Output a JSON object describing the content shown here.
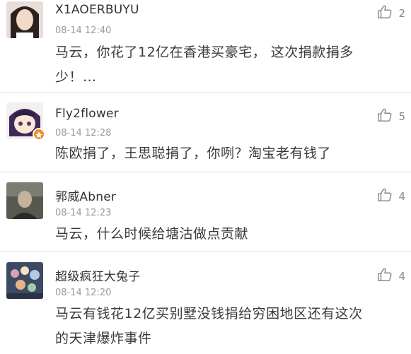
{
  "comments": [
    {
      "username": "X1AOERBUYU",
      "time": "08-14 12:40",
      "text_line1": "马云，你花了12亿在香港买豪宅， 这次捐款捐多",
      "text_line2": "少！…",
      "likes": "2",
      "avatar": "avatar-girl",
      "badge": false
    },
    {
      "username": "Fly2flower",
      "time": "08-14 12:28",
      "text_line1": "陈欧捐了，王思聪捐了，你咧？淘宝老有钱了",
      "text_line2": "",
      "likes": "5",
      "avatar": "avatar-anime",
      "badge": true
    },
    {
      "username": "郭威Abner",
      "time": "08-14 12:23",
      "text_line1": "马云，什么时候给塘沽做点贡献",
      "text_line2": "",
      "likes": "4",
      "avatar": "avatar-man",
      "badge": false
    },
    {
      "username": "超级疯狂大兔子",
      "time": "08-14 12:20",
      "text_line1": "马云有钱花12亿买别墅没钱捐给穷困地区还有这次",
      "text_line2": "的天津爆炸事件",
      "likes": "4",
      "avatar": "avatar-flowers",
      "badge": false
    }
  ],
  "icons": {
    "like": "thumbs-up-icon",
    "badge": "vip-star-icon"
  }
}
